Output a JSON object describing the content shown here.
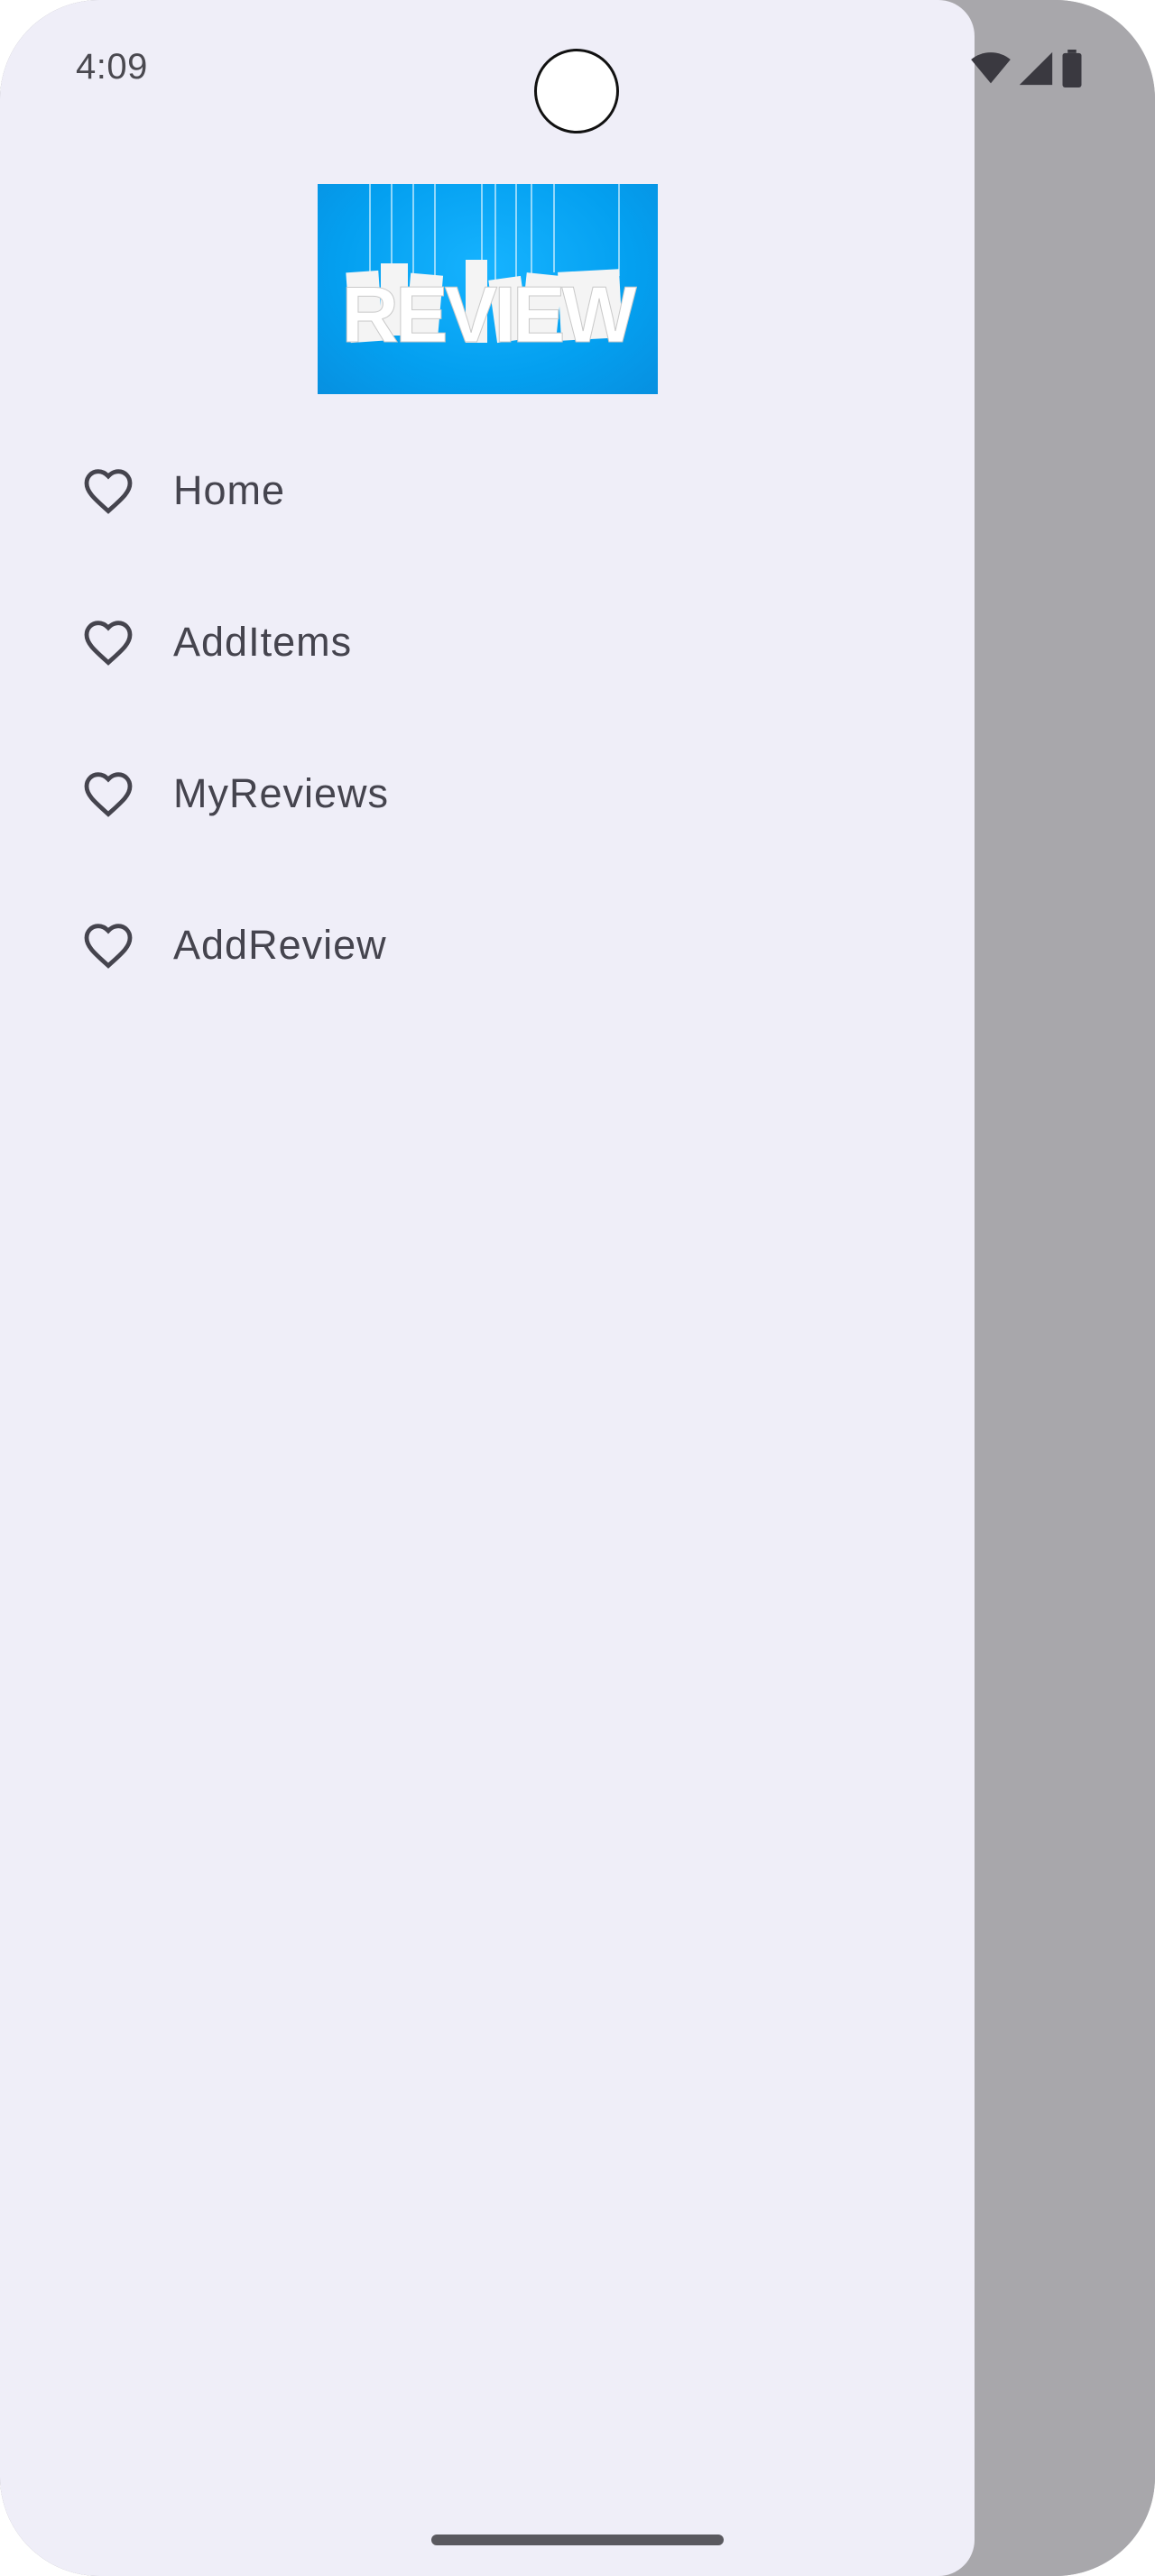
{
  "status_bar": {
    "time": "4:09",
    "icons": [
      "wifi-icon",
      "signal-icon",
      "battery-icon"
    ]
  },
  "drawer": {
    "logo": {
      "text": "REVIEW",
      "icon": "review-logo-image"
    },
    "items": [
      {
        "label": "Home",
        "icon": "heart-outline-icon"
      },
      {
        "label": "AddItems",
        "icon": "heart-outline-icon"
      },
      {
        "label": "MyReviews",
        "icon": "heart-outline-icon"
      },
      {
        "label": "AddReview",
        "icon": "heart-outline-icon"
      }
    ]
  },
  "colors": {
    "drawer_background": "#efeef8",
    "scrim": "#a8a7ab",
    "text": "#45444e",
    "logo_background": "#04a0f0"
  }
}
